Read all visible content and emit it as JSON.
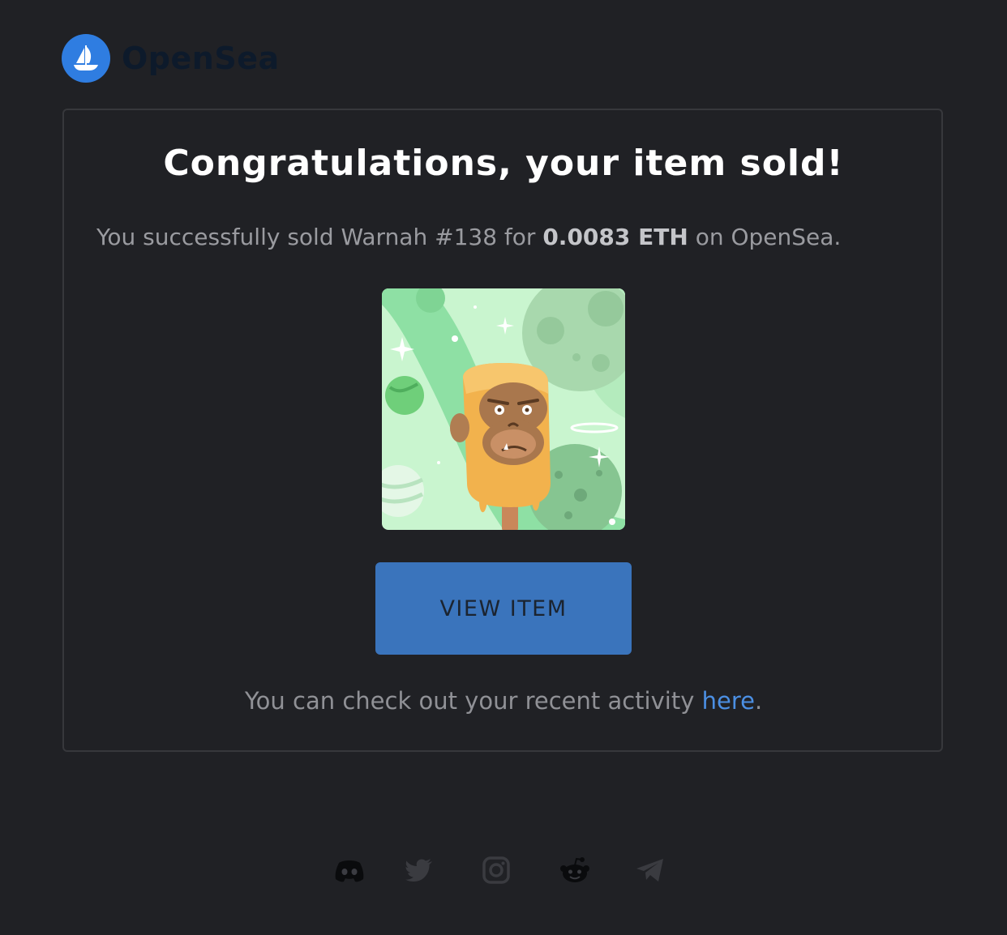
{
  "brand": {
    "name": "OpenSea"
  },
  "email": {
    "headline": "Congratulations, your item sold!",
    "summary_prefix": "You successfully sold Warnah #138 for ",
    "price": "0.0083 ETH",
    "summary_suffix": " on OpenSea.",
    "nft_alt": "Warnah #138",
    "button_label": "VIEW ITEM",
    "activity_prefix": "You can check out your recent activity ",
    "activity_link": "here",
    "activity_suffix": "."
  },
  "footer": {
    "socials": [
      "discord-icon",
      "twitter-icon",
      "instagram-icon",
      "reddit-icon",
      "telegram-icon"
    ]
  },
  "colors": {
    "background": "#202125",
    "brand_blue": "#2f7de1",
    "button": "#3a74bc",
    "link": "#4b8fe3"
  }
}
